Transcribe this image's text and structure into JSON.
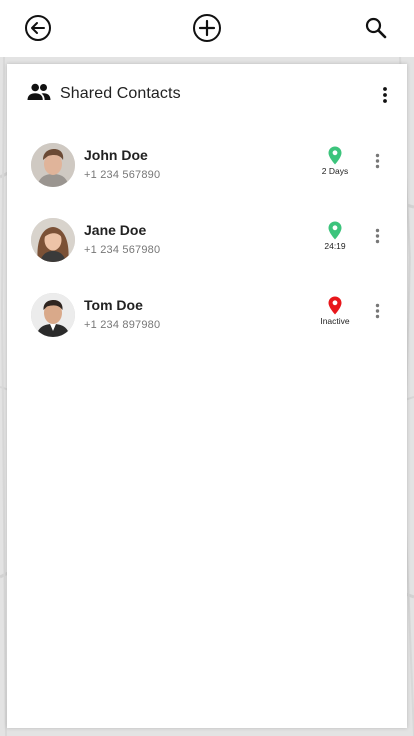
{
  "topbar": {
    "back_icon": "back-arrow-circle-icon",
    "add_icon": "plus-circle-icon",
    "search_icon": "search-icon"
  },
  "card": {
    "title": "Shared Contacts",
    "title_icon": "people-icon",
    "menu_icon": "more-vertical-icon"
  },
  "contacts": [
    {
      "name": "John Doe",
      "phone": "+1 234 567890",
      "status": "2 Days",
      "pin_color": "#3cc47c"
    },
    {
      "name": "Jane Doe",
      "phone": "+1 234 567980",
      "status": "24:19",
      "pin_color": "#3cc47c"
    },
    {
      "name": "Tom Doe",
      "phone": "+1 234 897980",
      "status": "Inactive",
      "pin_color": "#e8161b"
    }
  ],
  "colors": {
    "active": "#3cc47c",
    "inactive": "#e8161b",
    "map_bg": "#e3e3e3"
  }
}
